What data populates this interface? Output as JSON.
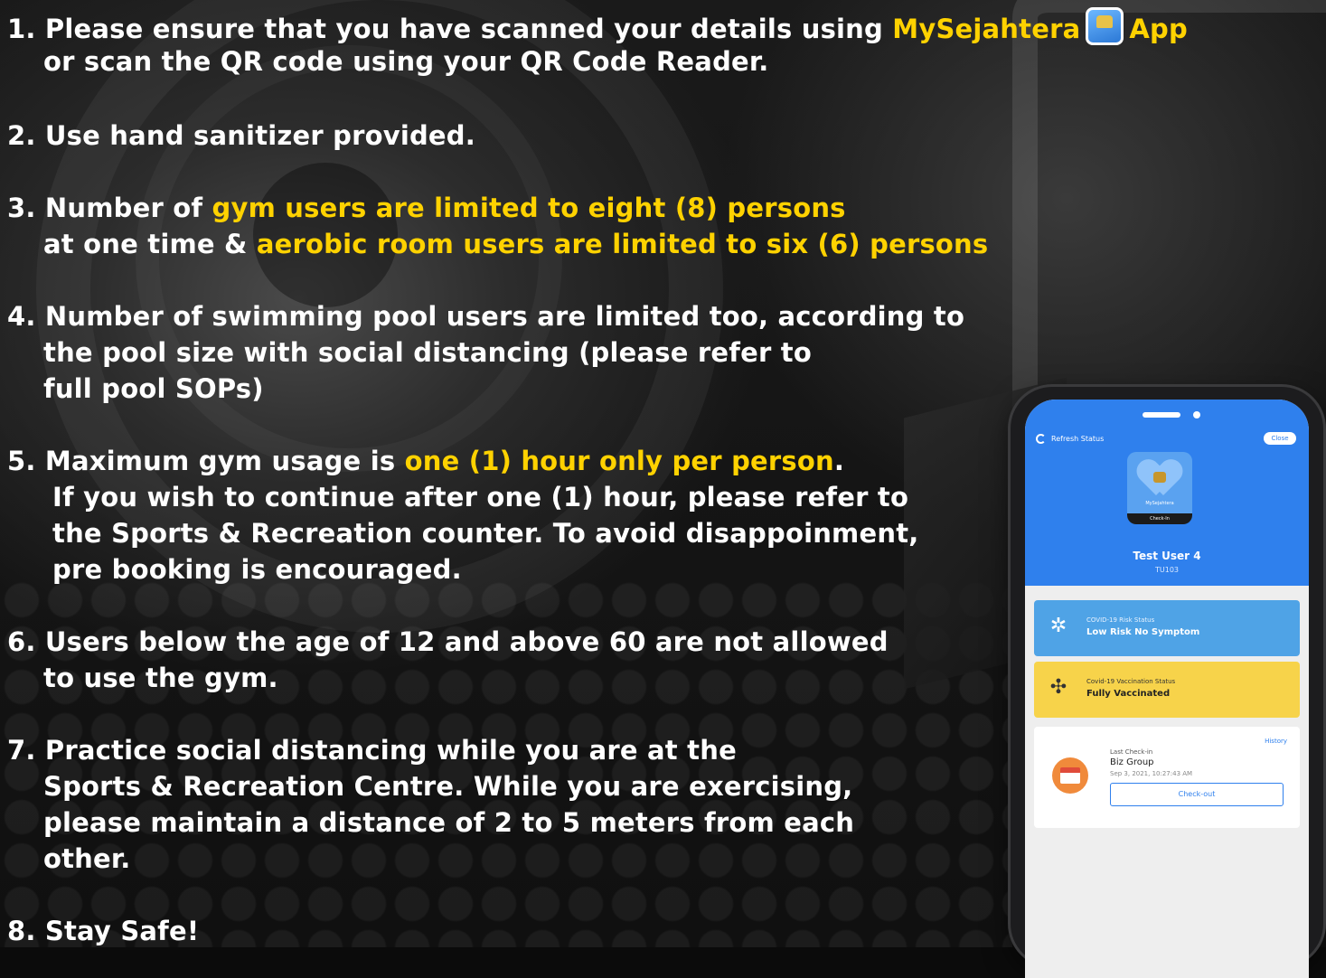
{
  "rules": {
    "r1": {
      "prefix": "1. Please ensure that you have scanned your details using ",
      "highlight": "MySejahtera",
      "suffix": "App",
      "line2": "or scan the QR code using your QR Code Reader."
    },
    "r2": {
      "text": "2. Use hand sanitizer provided."
    },
    "r3": {
      "prefix": "3. Number of ",
      "highlight1": "gym users are limited to eight (8) persons",
      "line2_prefix": "at one time & ",
      "highlight2": "aerobic room users are limited to six (6) persons"
    },
    "r4": {
      "line1": "4. Number of swimming pool users are limited too, according to",
      "line2": "the pool size with social distancing (please refer to",
      "line3": "full pool SOPs)"
    },
    "r5": {
      "prefix": "5.  Maximum gym usage is ",
      "highlight": "one (1) hour only per person",
      "suffix": ".",
      "line2": "If you wish to continue after one (1) hour, please refer to",
      "line3": "the Sports & Recreation counter. To avoid disappoinment,",
      "line4": "pre booking is encouraged."
    },
    "r6": {
      "line1": "6. Users below the age of 12 and above 60 are not allowed",
      "line2": "to use the gym."
    },
    "r7": {
      "line1": "7. Practice social distancing while you are at the",
      "line2": "Sports & Recreation Centre. While you are exercising,",
      "line3": "please maintain a distance of 2 to 5 meters from each",
      "line4": "other."
    },
    "r8": {
      "text": "8. Stay Safe!"
    }
  },
  "phone": {
    "refresh_label": "Refresh Status",
    "close_label": "Close",
    "app_name": "MySejahtera",
    "checkin_label": "Check-In",
    "user_name": "Test User 4",
    "user_id": "TU103",
    "risk": {
      "label": "COVID-19 Risk Status",
      "value": "Low Risk No Symptom",
      "color": "#4fa3e6"
    },
    "vaccination": {
      "label": "Covid-19 Vaccination Status",
      "value": "Fully Vaccinated",
      "color": "#f7d34a"
    },
    "history_label": "History",
    "last_checkin_label": "Last Check-in",
    "business": "Biz Group",
    "checkin_time": "Sep 3, 2021, 10:27:43 AM",
    "checkout_label": "Check-out"
  },
  "colors": {
    "highlight": "#ffd200",
    "text": "#ffffff",
    "app_blue": "#2f80ed"
  },
  "icons": [
    "mysejahtera-app-icon",
    "refresh-icon",
    "gear-virus-icon",
    "vaccine-icon",
    "shop-icon"
  ]
}
